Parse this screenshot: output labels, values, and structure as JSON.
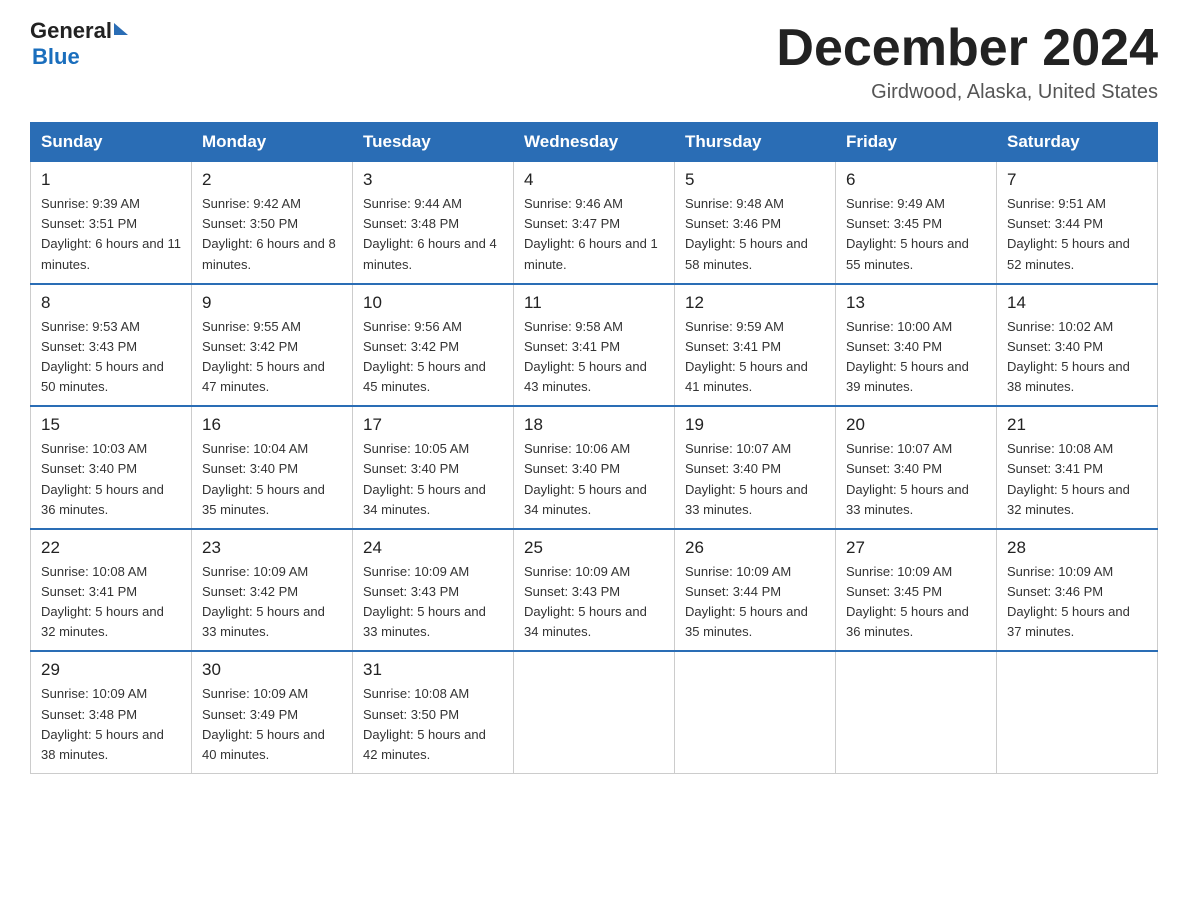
{
  "header": {
    "logo_general": "General",
    "logo_blue": "Blue",
    "title": "December 2024",
    "location": "Girdwood, Alaska, United States"
  },
  "weekdays": [
    "Sunday",
    "Monday",
    "Tuesday",
    "Wednesday",
    "Thursday",
    "Friday",
    "Saturday"
  ],
  "weeks": [
    [
      {
        "day": "1",
        "sunrise": "9:39 AM",
        "sunset": "3:51 PM",
        "daylight": "6 hours and 11 minutes."
      },
      {
        "day": "2",
        "sunrise": "9:42 AM",
        "sunset": "3:50 PM",
        "daylight": "6 hours and 8 minutes."
      },
      {
        "day": "3",
        "sunrise": "9:44 AM",
        "sunset": "3:48 PM",
        "daylight": "6 hours and 4 minutes."
      },
      {
        "day": "4",
        "sunrise": "9:46 AM",
        "sunset": "3:47 PM",
        "daylight": "6 hours and 1 minute."
      },
      {
        "day": "5",
        "sunrise": "9:48 AM",
        "sunset": "3:46 PM",
        "daylight": "5 hours and 58 minutes."
      },
      {
        "day": "6",
        "sunrise": "9:49 AM",
        "sunset": "3:45 PM",
        "daylight": "5 hours and 55 minutes."
      },
      {
        "day": "7",
        "sunrise": "9:51 AM",
        "sunset": "3:44 PM",
        "daylight": "5 hours and 52 minutes."
      }
    ],
    [
      {
        "day": "8",
        "sunrise": "9:53 AM",
        "sunset": "3:43 PM",
        "daylight": "5 hours and 50 minutes."
      },
      {
        "day": "9",
        "sunrise": "9:55 AM",
        "sunset": "3:42 PM",
        "daylight": "5 hours and 47 minutes."
      },
      {
        "day": "10",
        "sunrise": "9:56 AM",
        "sunset": "3:42 PM",
        "daylight": "5 hours and 45 minutes."
      },
      {
        "day": "11",
        "sunrise": "9:58 AM",
        "sunset": "3:41 PM",
        "daylight": "5 hours and 43 minutes."
      },
      {
        "day": "12",
        "sunrise": "9:59 AM",
        "sunset": "3:41 PM",
        "daylight": "5 hours and 41 minutes."
      },
      {
        "day": "13",
        "sunrise": "10:00 AM",
        "sunset": "3:40 PM",
        "daylight": "5 hours and 39 minutes."
      },
      {
        "day": "14",
        "sunrise": "10:02 AM",
        "sunset": "3:40 PM",
        "daylight": "5 hours and 38 minutes."
      }
    ],
    [
      {
        "day": "15",
        "sunrise": "10:03 AM",
        "sunset": "3:40 PM",
        "daylight": "5 hours and 36 minutes."
      },
      {
        "day": "16",
        "sunrise": "10:04 AM",
        "sunset": "3:40 PM",
        "daylight": "5 hours and 35 minutes."
      },
      {
        "day": "17",
        "sunrise": "10:05 AM",
        "sunset": "3:40 PM",
        "daylight": "5 hours and 34 minutes."
      },
      {
        "day": "18",
        "sunrise": "10:06 AM",
        "sunset": "3:40 PM",
        "daylight": "5 hours and 34 minutes."
      },
      {
        "day": "19",
        "sunrise": "10:07 AM",
        "sunset": "3:40 PM",
        "daylight": "5 hours and 33 minutes."
      },
      {
        "day": "20",
        "sunrise": "10:07 AM",
        "sunset": "3:40 PM",
        "daylight": "5 hours and 33 minutes."
      },
      {
        "day": "21",
        "sunrise": "10:08 AM",
        "sunset": "3:41 PM",
        "daylight": "5 hours and 32 minutes."
      }
    ],
    [
      {
        "day": "22",
        "sunrise": "10:08 AM",
        "sunset": "3:41 PM",
        "daylight": "5 hours and 32 minutes."
      },
      {
        "day": "23",
        "sunrise": "10:09 AM",
        "sunset": "3:42 PM",
        "daylight": "5 hours and 33 minutes."
      },
      {
        "day": "24",
        "sunrise": "10:09 AM",
        "sunset": "3:43 PM",
        "daylight": "5 hours and 33 minutes."
      },
      {
        "day": "25",
        "sunrise": "10:09 AM",
        "sunset": "3:43 PM",
        "daylight": "5 hours and 34 minutes."
      },
      {
        "day": "26",
        "sunrise": "10:09 AM",
        "sunset": "3:44 PM",
        "daylight": "5 hours and 35 minutes."
      },
      {
        "day": "27",
        "sunrise": "10:09 AM",
        "sunset": "3:45 PM",
        "daylight": "5 hours and 36 minutes."
      },
      {
        "day": "28",
        "sunrise": "10:09 AM",
        "sunset": "3:46 PM",
        "daylight": "5 hours and 37 minutes."
      }
    ],
    [
      {
        "day": "29",
        "sunrise": "10:09 AM",
        "sunset": "3:48 PM",
        "daylight": "5 hours and 38 minutes."
      },
      {
        "day": "30",
        "sunrise": "10:09 AM",
        "sunset": "3:49 PM",
        "daylight": "5 hours and 40 minutes."
      },
      {
        "day": "31",
        "sunrise": "10:08 AM",
        "sunset": "3:50 PM",
        "daylight": "5 hours and 42 minutes."
      },
      null,
      null,
      null,
      null
    ]
  ]
}
